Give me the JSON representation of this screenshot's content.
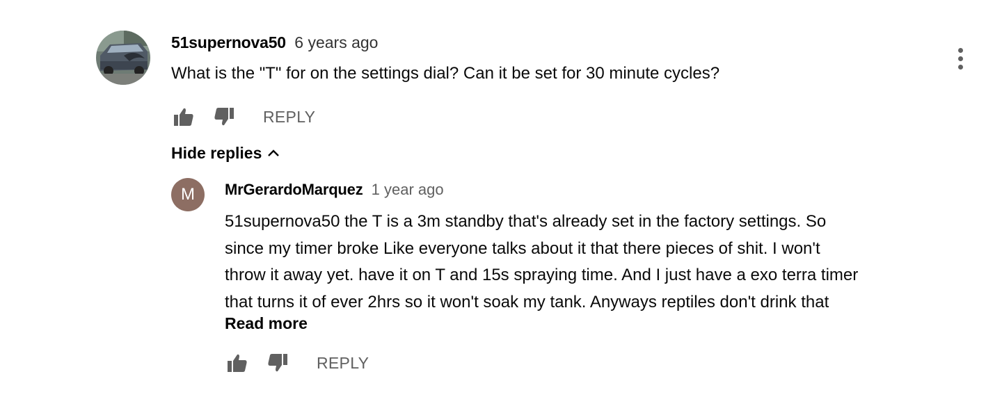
{
  "comment": {
    "author": "51supernova50",
    "timestamp": "6 years ago",
    "text": "What is the \"T\" for on the settings dial? Can it be set for 30 minute cycles?",
    "reply_label": "REPLY",
    "hide_replies_label": "Hide replies",
    "avatar": "car-photo-avatar"
  },
  "reply": {
    "avatar_letter": "M",
    "avatar_color": "#8d6e63",
    "author": "MrGerardoMarquez",
    "timestamp": "1 year ago",
    "text_lines": [
      "51supernova50 the T is a 3m standby that's already set in the factory settings. So",
      "since my timer broke Like everyone talks about it that there pieces of shit. I won't",
      "throw it away yet. have it on T and 15s spraying time. And I just have a exo terra timer",
      "that turns it of ever 2hrs so it won't soak my tank. Anyways reptiles don't drink that"
    ],
    "read_more_label": "Read more",
    "reply_label": "REPLY"
  },
  "icons": {
    "like": "thumbs-up-icon",
    "dislike": "thumbs-down-icon",
    "menu": "more-vertical-icon",
    "collapse": "chevron-up-icon"
  },
  "colors": {
    "icon_grey": "#606060",
    "text_primary": "#030303"
  }
}
